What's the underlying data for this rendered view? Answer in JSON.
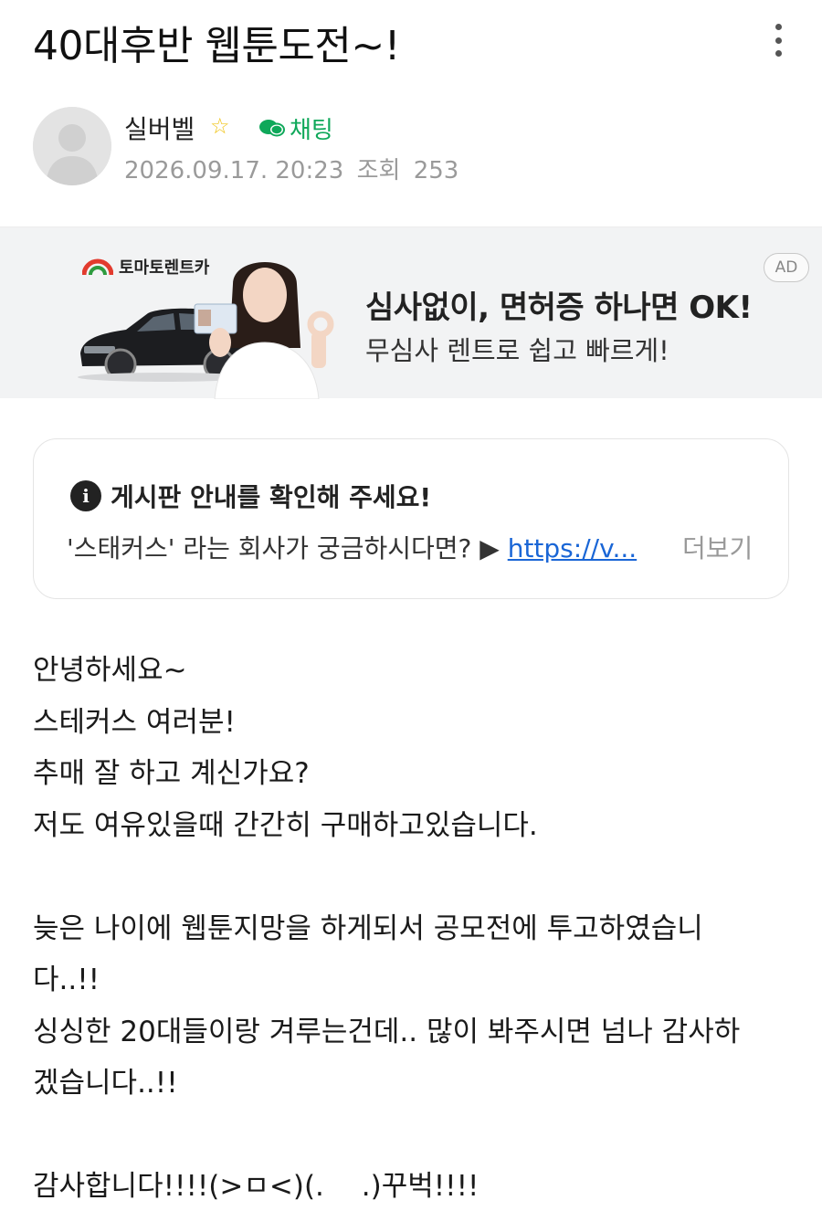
{
  "post": {
    "title": "40대후반 웹툰도전~!",
    "author": "실버벨",
    "chat_label": "채팅",
    "date": "2026.09.17. 20:23",
    "views_label": "조회",
    "views": "253"
  },
  "ad": {
    "brand": "토마토렌트카",
    "headline": "심사없이, 면허증 하나면 OK!",
    "subline": "무심사 렌트로 쉽고 빠르게!",
    "badge": "AD"
  },
  "notice": {
    "title": "게시판 안내를 확인해 주세요!",
    "text": "'스태커스' 라는 회사가 궁금하시다면? ▶ ",
    "link_text": "https://v...",
    "more_label": "더보기"
  },
  "content": {
    "lines": [
      "안녕하세요~",
      "스테커스 여러분!",
      "추매 잘 하고 계신가요?",
      "저도 여유있을때 간간히 구매하고있습니다.",
      "",
      "늦은 나이에 웹툰지망을 하게되서 공모전에 투고하였습니",
      "다..!!",
      "싱싱한 20대들이랑 겨루는건데.. 많이 봐주시면 넘나 감사하",
      "겠습니다..!!",
      "",
      "감사합니다!!!!(>ㅁ<)(.　 .)꾸벅!!!!"
    ]
  },
  "colors": {
    "chat_green": "#0fa85a",
    "link_blue": "#1a66d6",
    "meta_gray": "#9a9a9a",
    "star_yellow": "#f0c419"
  },
  "icons": [
    "more-vertical-icon",
    "avatar-placeholder",
    "star-icon",
    "chat-bubble-icon",
    "info-icon"
  ]
}
